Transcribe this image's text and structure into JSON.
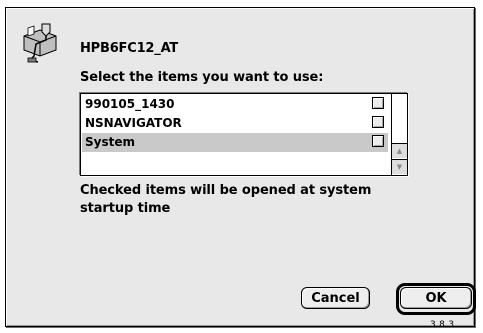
{
  "dialog": {
    "volume_name": "HPB6FC12_AT",
    "prompt": "Select the items you want to use:",
    "items": [
      {
        "label": "990105_1430",
        "checked": false,
        "selected": false
      },
      {
        "label": "NSNAVIGATOR",
        "checked": false,
        "selected": false
      },
      {
        "label": "System",
        "checked": false,
        "selected": true
      }
    ],
    "note": "Checked items will be opened at system startup time",
    "cancel_label": "Cancel",
    "ok_label": "OK",
    "version": "3.8.3"
  },
  "icons": {
    "volume": "shared-volume-icon",
    "scroll_up": "scroll-up-arrow-icon",
    "scroll_down": "scroll-down-arrow-icon"
  },
  "colors": {
    "dialog_bg": "#e8e8e8",
    "selection_bg": "#c9c9c9",
    "border": "#000000"
  }
}
